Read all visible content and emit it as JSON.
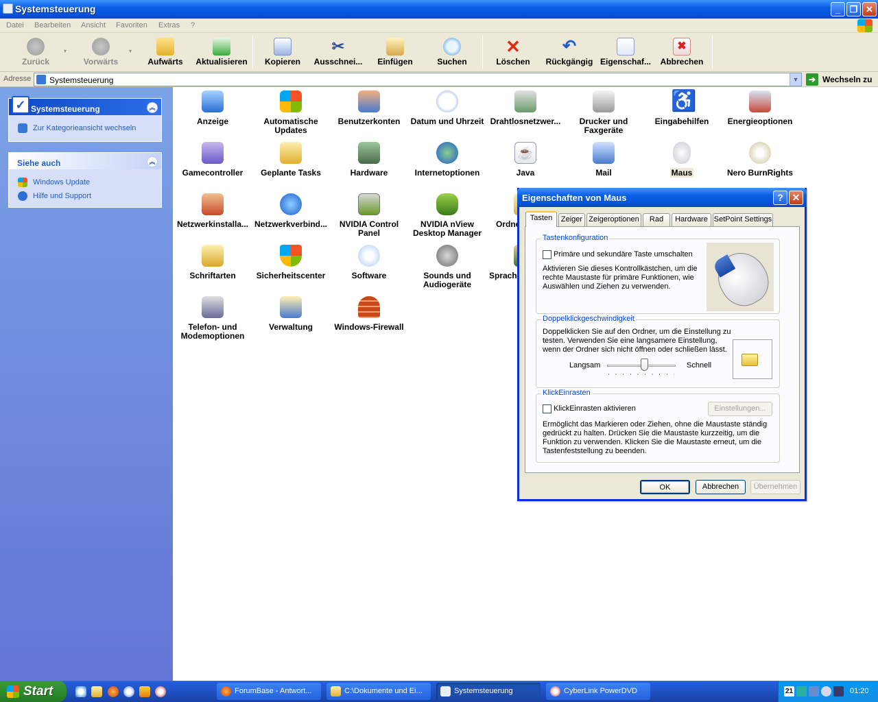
{
  "window": {
    "title": "Systemsteuerung",
    "buttons": {
      "minimize": "_",
      "maximize": "❐",
      "close": "✕"
    }
  },
  "menu": [
    "Datei",
    "Bearbeiten",
    "Ansicht",
    "Favoriten",
    "Extras",
    "?"
  ],
  "toolbar": {
    "back": "Zurück",
    "forward": "Vorwärts",
    "up": "Aufwärts",
    "refresh": "Aktualisieren",
    "copy": "Kopieren",
    "cut": "Ausschnei...",
    "paste": "Einfügen",
    "search": "Suchen",
    "delete": "Löschen",
    "undo": "Rückgängig",
    "properties": "Eigenschaf...",
    "cancel": "Abbrechen"
  },
  "address": {
    "label": "Adresse",
    "value": "Systemsteuerung",
    "go": "Wechseln zu"
  },
  "sidebar": {
    "pane1": {
      "title": "Systemsteuerung",
      "link": "Zur Kategorieansicht wechseln"
    },
    "pane2": {
      "title": "Siehe auch",
      "links": [
        "Windows Update",
        "Hilfe und Support"
      ]
    }
  },
  "items": [
    {
      "line1": "Anzeige",
      "line2": ""
    },
    {
      "line1": "Automatische",
      "line2": "Updates"
    },
    {
      "line1": "Benutzerkonten",
      "line2": ""
    },
    {
      "line1": "Datum und Uhrzeit",
      "line2": ""
    },
    {
      "line1": "Drahtlosnetzwer...",
      "line2": ""
    },
    {
      "line1": "Drucker und",
      "line2": "Faxgeräte"
    },
    {
      "line1": "Eingabehilfen",
      "line2": ""
    },
    {
      "line1": "Energieoptionen",
      "line2": ""
    },
    {
      "line1": "Gamecontroller",
      "line2": ""
    },
    {
      "line1": "Geplante Tasks",
      "line2": ""
    },
    {
      "line1": "Hardware",
      "line2": ""
    },
    {
      "line1": "Internetoptionen",
      "line2": ""
    },
    {
      "line1": "Java",
      "line2": ""
    },
    {
      "line1": "Mail",
      "line2": ""
    },
    {
      "line1": "Maus",
      "line2": ""
    },
    {
      "line1": "Nero BurnRights",
      "line2": ""
    },
    {
      "line1": "Netzwerkinstalla...",
      "line2": ""
    },
    {
      "line1": "Netzwerkverbind...",
      "line2": ""
    },
    {
      "line1": "NVIDIA Control",
      "line2": "Panel"
    },
    {
      "line1": "NVIDIA nView",
      "line2": "Desktop Manager"
    },
    {
      "line1": "Ordne",
      "line2": ""
    },
    {
      "line1": "Schriftarten",
      "line2": ""
    },
    {
      "line1": "Sicherheitscenter",
      "line2": ""
    },
    {
      "line1": "Software",
      "line2": ""
    },
    {
      "line1": "Sounds und",
      "line2": "Audiogeräte"
    },
    {
      "line1": "Sprach",
      "line2": ""
    },
    {
      "line1": "Telefon- und",
      "line2": "Modemoptionen"
    },
    {
      "line1": "Verwaltung",
      "line2": ""
    },
    {
      "line1": "Windows-Firewall",
      "line2": ""
    }
  ],
  "dialog": {
    "title": "Eigenschaften von Maus",
    "help": "?",
    "close": "✕",
    "tabs": [
      "Tasten",
      "Zeiger",
      "Zeigeroptionen",
      "Rad",
      "Hardware",
      "SetPoint Settings"
    ],
    "group1": {
      "label": "Tastenkonfiguration",
      "checkbox": "Primäre und sekundäre Taste umschalten",
      "desc1": "Aktivieren Sie dieses Kontrollkästchen, um die",
      "desc2": "rechte Maustaste für primäre Funktionen, wie",
      "desc3": "Auswählen und Ziehen zu verwenden."
    },
    "group2": {
      "label": "Doppelklickgeschwindigkeit",
      "desc1": "Doppelklicken Sie auf den Ordner, um die Einstellung zu",
      "desc2": "testen. Verwenden Sie eine langsamere Einstellung,",
      "desc3": "wenn der Ordner sich nicht öffnen oder schließen lässt.",
      "slow": "Langsam",
      "fast": "Schnell",
      "slider_fraction": 0.55
    },
    "group3": {
      "label": "KlickEinrasten",
      "checkbox": "KlickEinrasten aktivieren",
      "settings": "Einstellungen...",
      "desc1": "Ermöglicht das Markieren oder Ziehen, ohne die Maustaste ständig",
      "desc2": "gedrückt zu halten. Drücken Sie die Maustaste kurzzeitig, um die",
      "desc3": "Funktion zu verwenden. Klicken Sie die Maustaste erneut, um die",
      "desc4": "Tastenfeststellung zu beenden."
    },
    "ok": "OK",
    "cancel": "Abbrechen",
    "apply": "Übernehmen"
  },
  "taskbar": {
    "start": "Start",
    "tasks": [
      "ForumBase - Antwort...",
      "C:\\Dokumente und Ei...",
      "Systemsteuerung",
      "CyberLink PowerDVD"
    ],
    "tray_badge": "21",
    "clock": "01:20"
  },
  "colors": {
    "titlebar": "#0a5fe4",
    "sidebar": "#7ba2e7",
    "taskbar": "#245edb",
    "start": "#2e8b2e"
  }
}
